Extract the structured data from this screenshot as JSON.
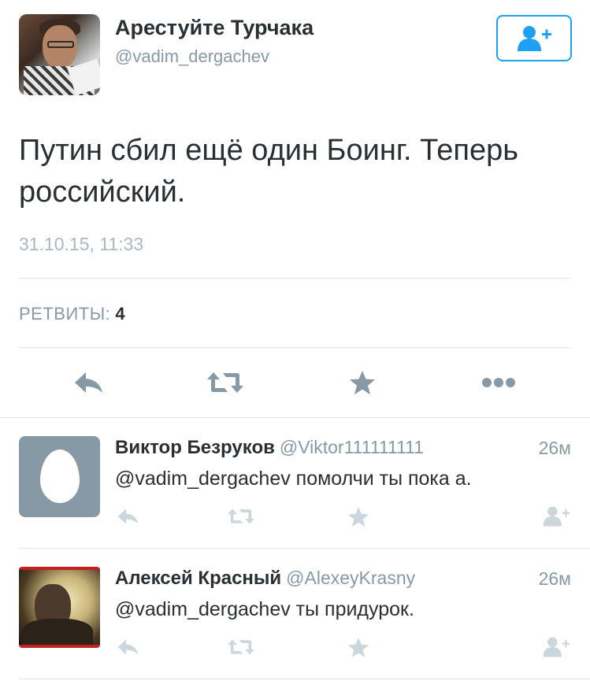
{
  "tweet": {
    "author_name": "Арестуйте Турчака",
    "author_handle": "@vadim_dergachev",
    "text": "Путин сбил ещё один Боинг. Теперь российский.",
    "timestamp": "31.10.15, 11:33",
    "retweets_label": "РЕТВИТЫ:",
    "retweets_count": "4"
  },
  "actions": {
    "reply_icon": "reply-icon",
    "retweet_icon": "retweet-icon",
    "like_icon": "star-icon",
    "more_icon": "more-icon",
    "follow_icon": "add-user-icon"
  },
  "replies": [
    {
      "name": "Виктор Безруков",
      "handle": "@Viktor111111111",
      "time": "26м",
      "text": "@vadim_dergachev помолчи ты пока а.",
      "avatar": "default-egg"
    },
    {
      "name": "Алексей Красный",
      "handle": "@AlexeyKrasny",
      "time": "26м",
      "text": "@vadim_dergachev ты придурок.",
      "avatar": "photo"
    }
  ],
  "colors": {
    "accent": "#1da1f2",
    "icon_gray": "#8899a6",
    "icon_light": "#ccd6dd",
    "divider": "#e1e8ed",
    "text": "#292f33"
  }
}
